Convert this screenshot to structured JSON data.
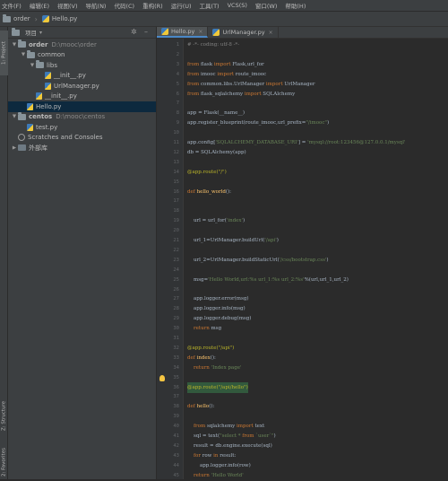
{
  "menu": [
    "文件(F)",
    "编辑(E)",
    "视图(V)",
    "导航(N)",
    "代码(C)",
    "重构(R)",
    "运行(U)",
    "工具(T)",
    "VCS(S)",
    "窗口(W)",
    "帮助(H)"
  ],
  "nav": {
    "project": "order",
    "file": "Hello.py"
  },
  "sidebar_tabs": {
    "project": "1: Project",
    "structure": "Z: Structure",
    "favorites": "2: Favorites"
  },
  "project_panel": {
    "title": "项目",
    "tree": [
      {
        "label": "order",
        "path": "D:\\mooc\\order",
        "level": 0,
        "kind": "folder",
        "open": true
      },
      {
        "label": "common",
        "path": "",
        "level": 1,
        "kind": "folder",
        "open": true
      },
      {
        "label": "libs",
        "path": "",
        "level": 2,
        "kind": "folder",
        "open": true
      },
      {
        "label": "__init__.py",
        "path": "",
        "level": 3,
        "kind": "file"
      },
      {
        "label": "UrlManager.py",
        "path": "",
        "level": 3,
        "kind": "file"
      },
      {
        "label": "__init__.py",
        "path": "",
        "level": 2,
        "kind": "file"
      },
      {
        "label": "Hello.py",
        "path": "",
        "level": 1,
        "kind": "file",
        "selected": true
      },
      {
        "label": "centos",
        "path": "D:\\mooc\\centos",
        "level": 0,
        "kind": "folder",
        "open": true
      },
      {
        "label": "test.py",
        "path": "",
        "level": 1,
        "kind": "file"
      },
      {
        "label": "Scratches and Consoles",
        "path": "",
        "level": 0,
        "kind": "scratch"
      },
      {
        "label": "外部库",
        "path": "",
        "level": 0,
        "kind": "lib"
      }
    ]
  },
  "tabs": [
    {
      "label": "Hello.py",
      "active": true
    },
    {
      "label": "UrlManager.py",
      "active": false
    }
  ],
  "code": {
    "line_start": 1,
    "lines": [
      "# -*- coding: utf-8 -*-",
      "",
      "from flask import Flask,url_for",
      "from imooc import route_imooc",
      "from common.libs.UrlManager import UrlManager",
      "from flask_sqlalchemy import SQLAlchemy",
      "",
      "app = Flask(__name__)",
      "app.register_blueprint(route_imooc,url_prefix=\"/imooc\")",
      "",
      "app.config['SQLALCHEMY_DATABASE_URI'] = 'mysql://root:123456@127.0.0.1/mysql'",
      "db = SQLAlchemy(app)",
      "",
      "@app.route(\"/\")",
      "",
      "def hello_world():",
      "",
      "",
      "    url = url_for('index')",
      "",
      "    url_1=UrlManager.buildUrl('/api')",
      "",
      "    url_2=UrlManager.buildStaticUrl('/css/bootstrap.css')",
      "",
      "    msg='Hello World,url:%s url_1:%s url_2:%s'%(url,url_1,url_2)",
      "",
      "    app.logger.error(msg)",
      "    app.logger.info(msg)",
      "    app.logger.debug(msg)",
      "    return msg",
      "",
      "@app.route(\"/api\")",
      "def index():",
      "    return 'Index page'",
      "",
      "@app.route(\"/api/hello\")",
      "",
      "def hello():",
      "",
      "    from sqlalchemy import text",
      "    sql = text(\"select * from `user`\")",
      "    result = db.engine.execute(sql)",
      "    for row in result:",
      "        app.logger.info(row)",
      "    return 'Hello World'"
    ]
  }
}
